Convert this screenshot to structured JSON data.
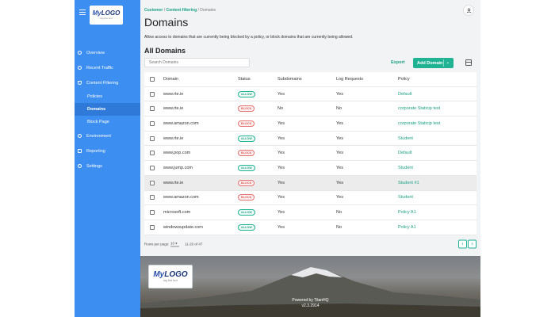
{
  "brand": {
    "logo_text_my": "My",
    "logo_text_logo": "LOGO",
    "logo_tagline": "tag line text"
  },
  "sidebar": {
    "items": [
      {
        "label": "Overview",
        "icon": "info-circle-icon"
      },
      {
        "label": "Recent Traffic",
        "icon": "clock-icon"
      },
      {
        "label": "Content Filtering",
        "icon": "shield-icon"
      },
      {
        "label": "Environment",
        "icon": "globe-icon"
      },
      {
        "label": "Reporting",
        "icon": "document-icon"
      },
      {
        "label": "Settings",
        "icon": "gear-icon"
      }
    ],
    "sub_items": [
      {
        "label": "Policies",
        "active": false
      },
      {
        "label": "Domains",
        "active": true
      },
      {
        "label": "Block Page",
        "active": false
      }
    ]
  },
  "breadcrumb": {
    "root": "Customer",
    "sep1": "/",
    "parent": "Content filtering",
    "sep2": "/",
    "current": "Domains"
  },
  "header": {
    "title": "Domains",
    "description": "Allow access to domains that are currently being blocked by a policy, or block domains that are currently being allowed."
  },
  "section": {
    "title": "All Domains",
    "search_placeholder": "Search Domains",
    "export_label": "Export",
    "add_label": "Add Domain"
  },
  "table": {
    "headers": {
      "domain": "Domain",
      "status": "Status",
      "subdomains": "Subdomains",
      "log": "Log Requests",
      "policy": "Policy"
    },
    "rows": [
      {
        "domain": "www.rte.ie",
        "status": "ALLOW",
        "subdomains": "Yes",
        "log": "Yes",
        "policy": "Default"
      },
      {
        "domain": "www.rte.ie",
        "status": "BLOCK",
        "subdomains": "No",
        "log": "No",
        "policy": "corporate Staticip test"
      },
      {
        "domain": "www.amazon.com",
        "status": "BLOCK",
        "subdomains": "Yes",
        "log": "Yes",
        "policy": "corporate Staticip test"
      },
      {
        "domain": "www.rte.ie",
        "status": "ALLOW",
        "subdomains": "Yes",
        "log": "Yes",
        "policy": "Student"
      },
      {
        "domain": "www.pop.com",
        "status": "BLOCK",
        "subdomains": "Yes",
        "log": "Yes",
        "policy": "Default"
      },
      {
        "domain": "www.jump.com",
        "status": "ALLOW",
        "subdomains": "Yes",
        "log": "Yes",
        "policy": "Student"
      },
      {
        "domain": "www.rte.ie",
        "status": "BLOCK",
        "subdomains": "Yes",
        "log": "Yes",
        "policy": "Student #1",
        "highlighted": true
      },
      {
        "domain": "www.amazon.com",
        "status": "BLOCK",
        "subdomains": "Yes",
        "log": "Yes",
        "policy": "Student"
      },
      {
        "domain": "microsoft.com",
        "status": "ALLOW",
        "subdomains": "Yes",
        "log": "No",
        "policy": "Policy A1"
      },
      {
        "domain": "windowsupdate.com",
        "status": "ALLOW",
        "subdomains": "Yes",
        "log": "No",
        "policy": "Policy A1"
      }
    ],
    "footer": {
      "rows_per_page_label": "Rows per page:",
      "rows_per_page": "10",
      "range": "11-20 of 47"
    }
  },
  "footer": {
    "powered_by": "Powered by TitanHQ",
    "version": "v2.3.2914"
  },
  "colors": {
    "sidebar": "#3d8ef1",
    "accent": "#1fb394",
    "link": "#1aa083",
    "block": "#d9534f"
  }
}
